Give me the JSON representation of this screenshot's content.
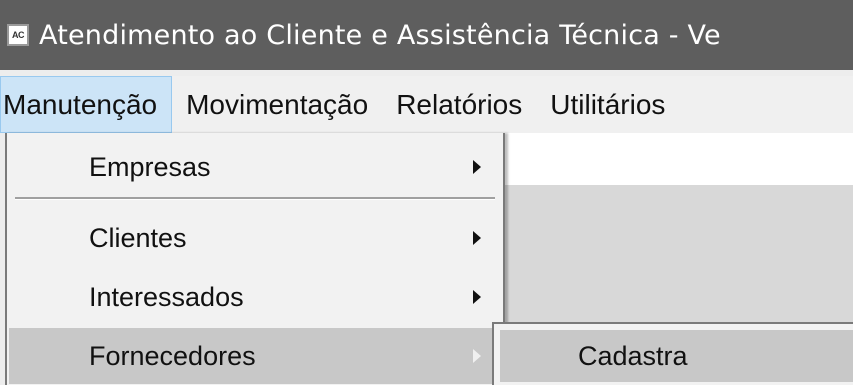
{
  "window": {
    "icon_text": "AC",
    "title": "Atendimento ao Cliente e Assistência Técnica - Ve"
  },
  "menubar": {
    "items": [
      {
        "label": "Manutenção"
      },
      {
        "label": "Movimentação"
      },
      {
        "label": "Relatórios"
      },
      {
        "label": "Utilitários"
      }
    ]
  },
  "dropdown": {
    "items": [
      {
        "label": "Empresas"
      },
      {
        "label": "Clientes"
      },
      {
        "label": "Interessados"
      },
      {
        "label": "Fornecedores"
      }
    ]
  },
  "submenu": {
    "items": [
      {
        "label": "Cadastra"
      }
    ]
  }
}
